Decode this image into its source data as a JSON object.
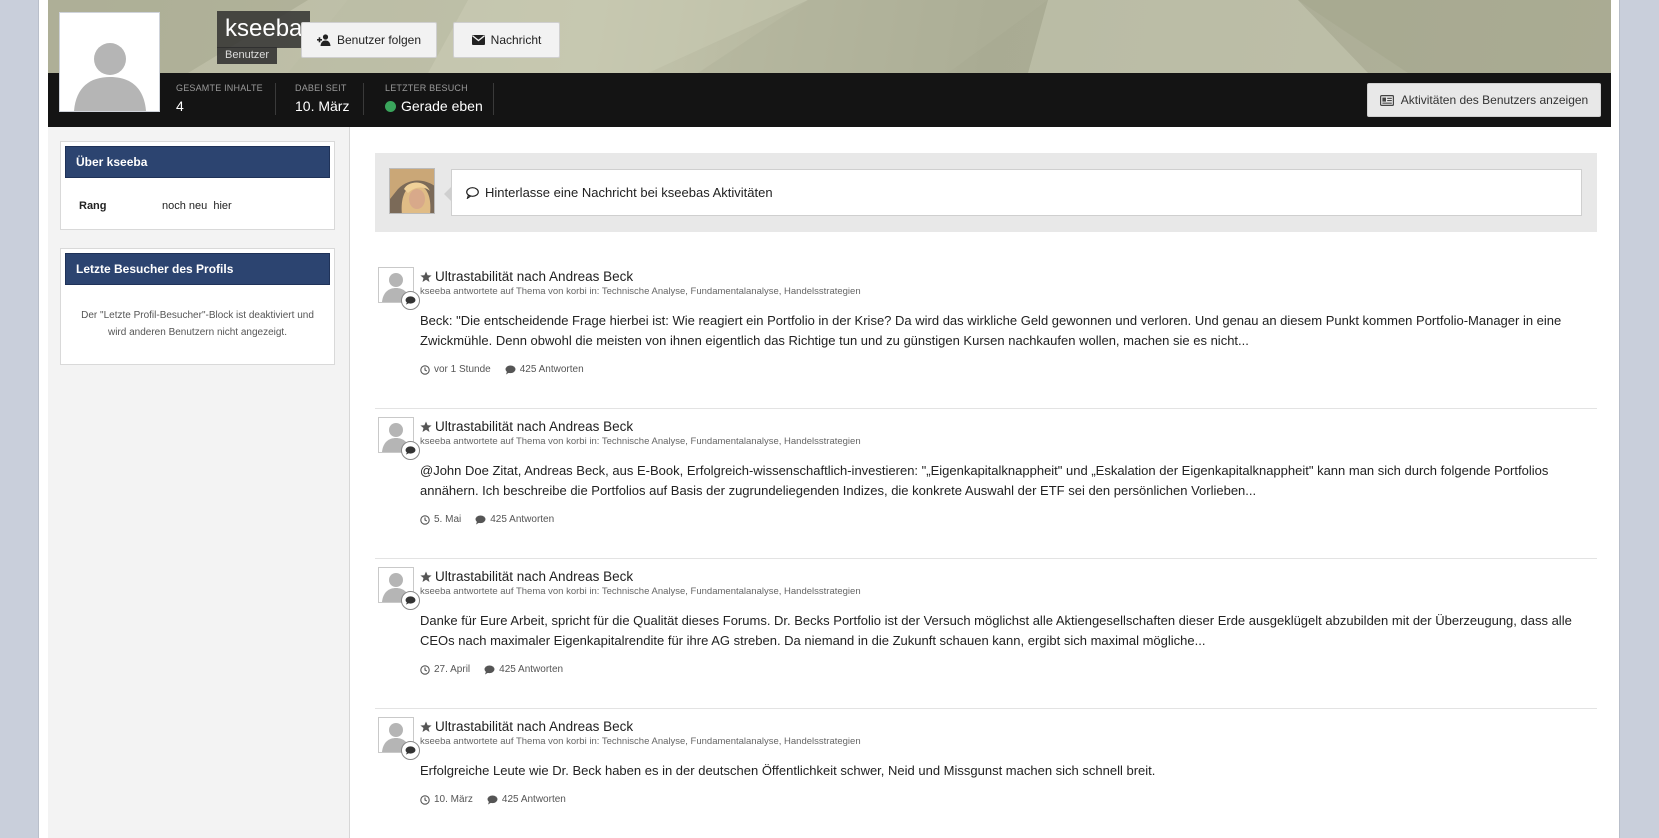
{
  "profile": {
    "username": "kseeba",
    "role": "Benutzer",
    "follow_label": "Benutzer folgen",
    "message_label": "Nachricht"
  },
  "stats": [
    {
      "label": "Gesamte Inhalte",
      "value": "4"
    },
    {
      "label": "Dabei seit",
      "value": "10. März"
    },
    {
      "label": "Letzter Besuch",
      "value": "Gerade eben"
    }
  ],
  "activity_button_label": "Aktivitäten des Benutzers anzeigen",
  "sidebar": {
    "about_title": "Über kseeba",
    "rank_label": "Rang",
    "rank_value": "noch neu  hier",
    "visitors_title": "Letzte Besucher des Profils",
    "visitors_note": "Der \"Letzte Profil-Besucher\"-Block ist deaktiviert und wird anderen Benutzern nicht angezeigt."
  },
  "composer": {
    "placeholder": "Hinterlasse eine Nachricht bei kseebas Aktivitäten"
  },
  "feed": [
    {
      "title": "Ultrastabilität nach Andreas Beck",
      "meta": "kseeba antwortete auf Thema von korbi in: Technische Analyse, Fundamentalanalyse, Handelsstrategien",
      "text": "Beck: \"Die entscheidende Frage hierbei ist: Wie reagiert ein Portfolio in der Krise? Da wird das wirkliche Geld gewonnen und verloren. Und genau an diesem Punkt kommen Portfolio-Manager in eine Zwickmühle. Denn obwohl die meisten von ihnen eigentlich das Richtige tun und zu günstigen Kursen nachkaufen wollen, machen sie es nicht...",
      "time": "vor 1 Stunde",
      "replies": "425 Antworten"
    },
    {
      "title": "Ultrastabilität nach Andreas Beck",
      "meta": "kseeba antwortete auf Thema von korbi in: Technische Analyse, Fundamentalanalyse, Handelsstrategien",
      "text": "@John Doe Zitat, Andreas Beck, aus E-Book, Erfolgreich-wissenschaftlich-investieren: \"„Eigenkapitalknappheit\" und „Eskalation der Eigenkapitalknappheit\" kann man sich durch folgende Portfolios annähern. Ich beschreibe die Portfolios auf Basis der zugrundeliegenden Indizes, die konkrete Auswahl der ETF sei den persönlichen Vorlieben...",
      "time": "5. Mai",
      "replies": "425 Antworten"
    },
    {
      "title": "Ultrastabilität nach Andreas Beck",
      "meta": "kseeba antwortete auf Thema von korbi in: Technische Analyse, Fundamentalanalyse, Handelsstrategien",
      "text": "Danke für Eure Arbeit, spricht für die Qualität dieses Forums. Dr. Becks Portfolio ist der Versuch möglichst alle Aktiengesellschaften dieser Erde ausgeklügelt abzubilden mit der Überzeugung, dass alle CEOs nach maximaler Eigenkapitalrendite für ihre AG streben. Da niemand in die Zukunft schauen kann, ergibt sich maximal mögliche...",
      "time": "27. April",
      "replies": "425 Antworten"
    },
    {
      "title": "Ultrastabilität nach Andreas Beck",
      "meta": "kseeba antwortete auf Thema von korbi in: Technische Analyse, Fundamentalanalyse, Handelsstrategien",
      "text": "Erfolgreiche Leute wie Dr. Beck haben es in der deutschen Öffentlichkeit schwer, Neid und Missgunst machen sich schnell breit.",
      "time": "10. März",
      "replies": "425 Antworten"
    }
  ],
  "colors": {
    "widget_header": "#2c4470",
    "stats_bar": "#141414",
    "online_dot": "#3aa55c"
  },
  "icons": {
    "follow": "user-plus-icon",
    "message": "envelope-icon",
    "activity": "id-card-icon",
    "composer": "speech-bubble-icon",
    "item_title": "star-icon",
    "time": "clock-icon",
    "replies": "comment-icon"
  }
}
